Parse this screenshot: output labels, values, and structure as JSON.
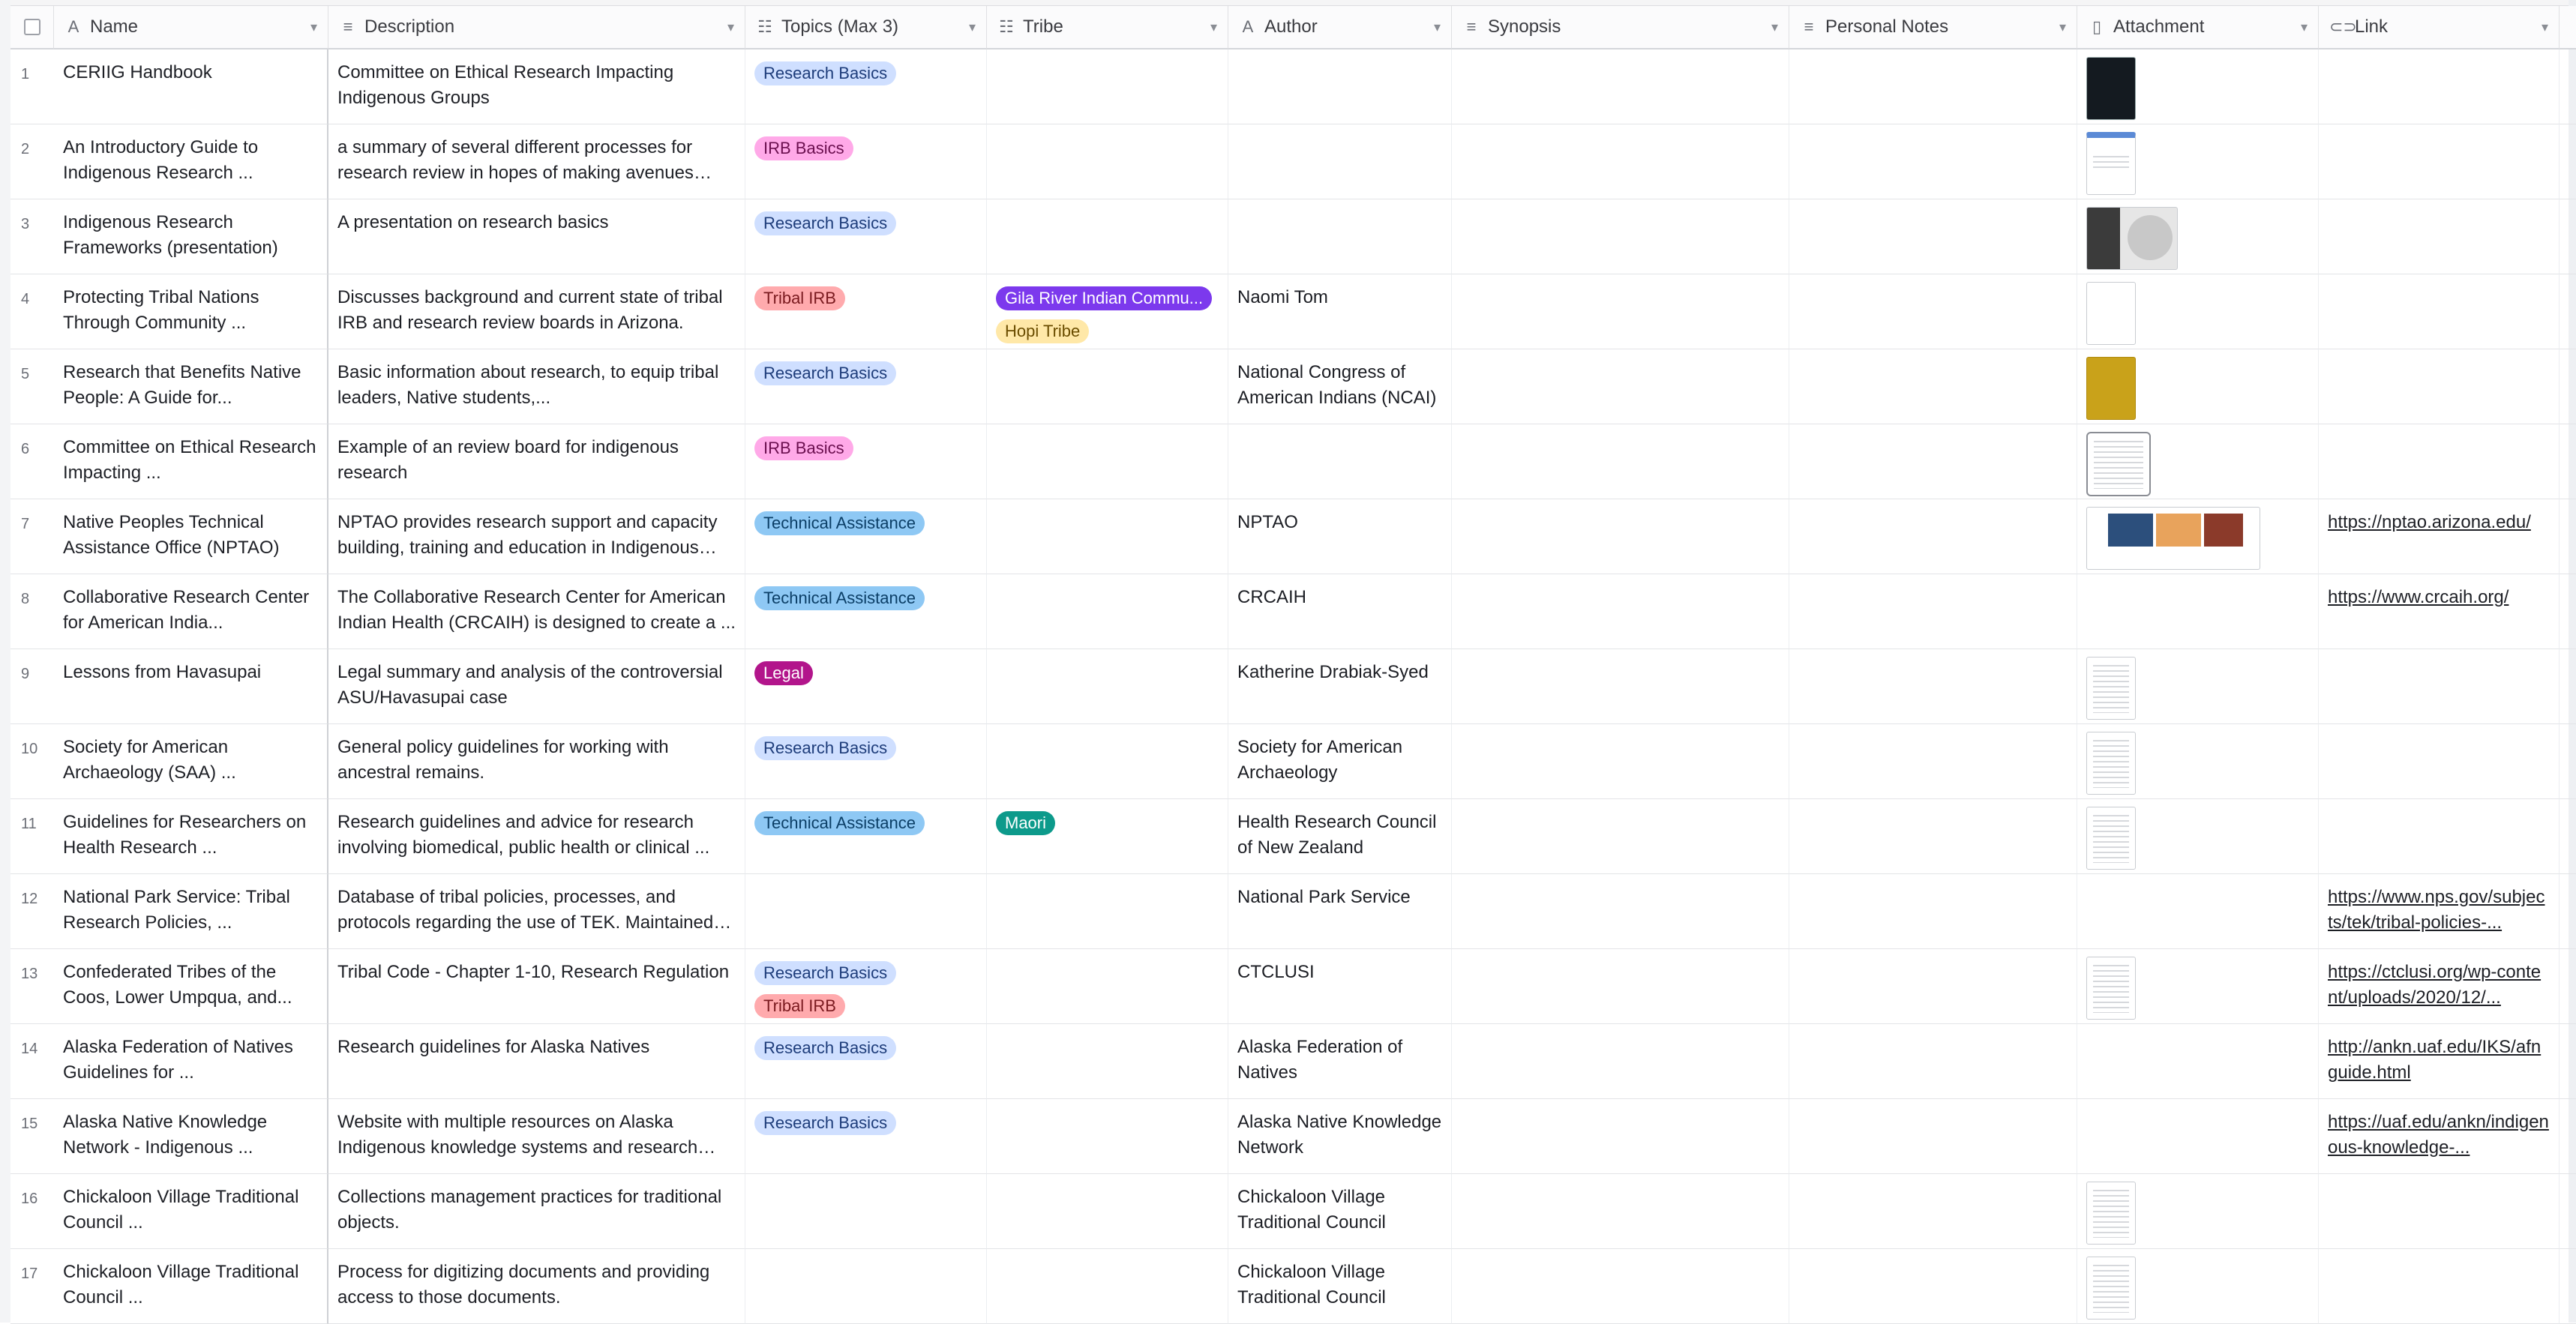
{
  "columns": [
    {
      "label": "Name",
      "icon": "A"
    },
    {
      "label": "Description",
      "icon": "≡"
    },
    {
      "label": "Topics (Max 3)",
      "icon": "☷"
    },
    {
      "label": "Tribe",
      "icon": "☷"
    },
    {
      "label": "Author",
      "icon": "A"
    },
    {
      "label": "Synopsis",
      "icon": "≡"
    },
    {
      "label": "Personal Notes",
      "icon": "≡"
    },
    {
      "label": "Attachment",
      "icon": "▯"
    },
    {
      "label": "Link",
      "icon": "⊂⊃"
    }
  ],
  "tag_colors": {
    "Research Basics": {
      "bg": "#cfdfff",
      "fg": "#1d3c7a"
    },
    "IRB Basics": {
      "bg": "#ffa9e8",
      "fg": "#6b0f4f"
    },
    "Tribal IRB": {
      "bg": "#ffaaad",
      "fg": "#7a1a1f"
    },
    "Technical Assistance": {
      "bg": "#8ec8f4",
      "fg": "#0b3e66"
    },
    "Legal": {
      "bg": "#b2158b",
      "fg": "#ffffff"
    },
    "Gila River Indian Commu...": {
      "bg": "#7c39ed",
      "fg": "#ffffff"
    },
    "Hopi Tribe": {
      "bg": "#ffe8a8",
      "fg": "#6b4d00"
    },
    "Maori": {
      "bg": "#0d9a8b",
      "fg": "#ffffff"
    }
  },
  "rows": [
    {
      "num": "1",
      "name": "CERIIG Handbook",
      "description": "Committee on Ethical Research Impacting Indigenous Groups",
      "topics": [
        "Research Basics"
      ],
      "tribe": [],
      "author": "",
      "synopsis": "",
      "notes": "",
      "attachments": [
        "dark-doc"
      ],
      "link": ""
    },
    {
      "num": "2",
      "name": "An Introductory Guide to Indigenous Research ...",
      "description": "a summary of several different processes for research review in hopes of making avenues more...",
      "topics": [
        "IRB Basics"
      ],
      "tribe": [],
      "author": "",
      "synopsis": "",
      "notes": "",
      "attachments": [
        "blue-doc"
      ],
      "link": ""
    },
    {
      "num": "3",
      "name": "Indigenous Research Frameworks (presentation)",
      "description": "A presentation on research basics",
      "topics": [
        "Research Basics"
      ],
      "tribe": [],
      "author": "",
      "synopsis": "",
      "notes": "",
      "attachments": [
        "slide-doc"
      ],
      "link": ""
    },
    {
      "num": "4",
      "name": "Protecting Tribal Nations Through Community ...",
      "description": "Discusses background and current state of tribal IRB and research review boards in Arizona.",
      "topics": [
        "Tribal IRB"
      ],
      "tribe": [
        "Gila River Indian Commu...",
        "Hopi Tribe"
      ],
      "author": "Naomi Tom",
      "synopsis": "",
      "notes": "",
      "attachments": [
        "blank-doc"
      ],
      "link": ""
    },
    {
      "num": "5",
      "name": "Research that Benefits Native People: A Guide for...",
      "description": "Basic information about research, to equip tribal leaders, Native students,...",
      "topics": [
        "Research Basics"
      ],
      "tribe": [],
      "author": "National Congress of American Indians (NCAI)",
      "synopsis": "",
      "notes": "",
      "attachments": [
        "gold-doc"
      ],
      "link": ""
    },
    {
      "num": "6",
      "name": "Committee on Ethical Research Impacting ...",
      "description": "Example of an review board for indigenous research",
      "topics": [
        "IRB Basics"
      ],
      "tribe": [],
      "author": "",
      "synopsis": "",
      "notes": "",
      "attachments": [
        "file-icon"
      ],
      "link": ""
    },
    {
      "num": "7",
      "name": "Native Peoples Technical Assistance Office (NPTAO)",
      "description": "NPTAO provides research support and capacity building, training and education in Indigenous law...",
      "topics": [
        "Technical Assistance"
      ],
      "tribe": [],
      "author": "NPTAO",
      "synopsis": "",
      "notes": "",
      "attachments": [
        "web-doc"
      ],
      "link": "https://nptao.arizona.edu/"
    },
    {
      "num": "8",
      "name": "Collaborative Research Center for American India...",
      "description": "The Collaborative Research Center for American Indian Health (CRCAIH) is designed to create a ...",
      "topics": [
        "Technical Assistance"
      ],
      "tribe": [],
      "author": "CRCAIH",
      "synopsis": "",
      "notes": "",
      "attachments": [],
      "link": "https://www.crcaih.org/"
    },
    {
      "num": "9",
      "name": "Lessons from Havasupai",
      "description": "Legal summary and analysis of the controversial ASU/Havasupai case",
      "topics": [
        "Legal"
      ],
      "tribe": [],
      "author": "Katherine Drabiak-Syed",
      "synopsis": "",
      "notes": "",
      "attachments": [
        "text-doc"
      ],
      "link": ""
    },
    {
      "num": "10",
      "name": "Society for American Archaeology (SAA) ...",
      "description": "General policy guidelines for working with ancestral remains.",
      "topics": [
        "Research Basics"
      ],
      "tribe": [],
      "author": "Society for American Archaeology",
      "synopsis": "",
      "notes": "",
      "attachments": [
        "text-doc"
      ],
      "link": ""
    },
    {
      "num": "11",
      "name": "Guidelines for Researchers on Health Research ...",
      "description": "Research guidelines and advice for research involving biomedical, public health or clinical ...",
      "topics": [
        "Technical Assistance"
      ],
      "tribe": [
        "Maori"
      ],
      "author": "Health Research Council of New Zealand",
      "synopsis": "",
      "notes": "",
      "attachments": [
        "title-doc"
      ],
      "link": ""
    },
    {
      "num": "12",
      "name": "National Park Service: Tribal Research Policies, ...",
      "description": "Database of tribal policies, processes, and protocols regarding the use of TEK. Maintained by the ...",
      "topics": [],
      "tribe": [],
      "author": "National Park Service",
      "synopsis": "",
      "notes": "",
      "attachments": [],
      "link": "https://www.nps.gov/subjects/tek/tribal-policies-..."
    },
    {
      "num": "13",
      "name": "Confederated Tribes of the Coos, Lower Umpqua, and...",
      "description": "Tribal Code - Chapter 1-10, Research Regulation",
      "topics": [
        "Research Basics",
        "Tribal IRB"
      ],
      "tribe": [],
      "author": "CTCLUSI",
      "synopsis": "",
      "notes": "",
      "attachments": [
        "text-doc"
      ],
      "link": "https://ctclusi.org/wp-content/uploads/2020/12/..."
    },
    {
      "num": "14",
      "name": "Alaska Federation of Natives Guidelines for ...",
      "description": "Research guidelines for Alaska Natives",
      "topics": [
        "Research Basics"
      ],
      "tribe": [],
      "author": "Alaska Federation of Natives",
      "synopsis": "",
      "notes": "",
      "attachments": [],
      "link": "http://ankn.uaf.edu/IKS/afnguide.html"
    },
    {
      "num": "15",
      "name": "Alaska Native Knowledge Network - Indigenous ...",
      "description": "Website with multiple resources on Alaska Indigenous knowledge systems and research best ...",
      "topics": [
        "Research Basics"
      ],
      "tribe": [],
      "author": "Alaska Native Knowledge Network",
      "synopsis": "",
      "notes": "",
      "attachments": [],
      "link": "https://uaf.edu/ankn/indigenous-knowledge-..."
    },
    {
      "num": "16",
      "name": "Chickaloon Village Traditional Council ...",
      "description": "Collections management practices for traditional objects.",
      "topics": [],
      "tribe": [],
      "author": "Chickaloon Village Traditional Council",
      "synopsis": "",
      "notes": "",
      "attachments": [
        "text-doc"
      ],
      "link": ""
    },
    {
      "num": "17",
      "name": "Chickaloon Village Traditional Council ...",
      "description": "Process for digitizing documents and providing access to those documents.",
      "topics": [],
      "tribe": [],
      "author": "Chickaloon Village Traditional Council",
      "synopsis": "",
      "notes": "",
      "attachments": [
        "text-doc"
      ],
      "link": ""
    }
  ]
}
